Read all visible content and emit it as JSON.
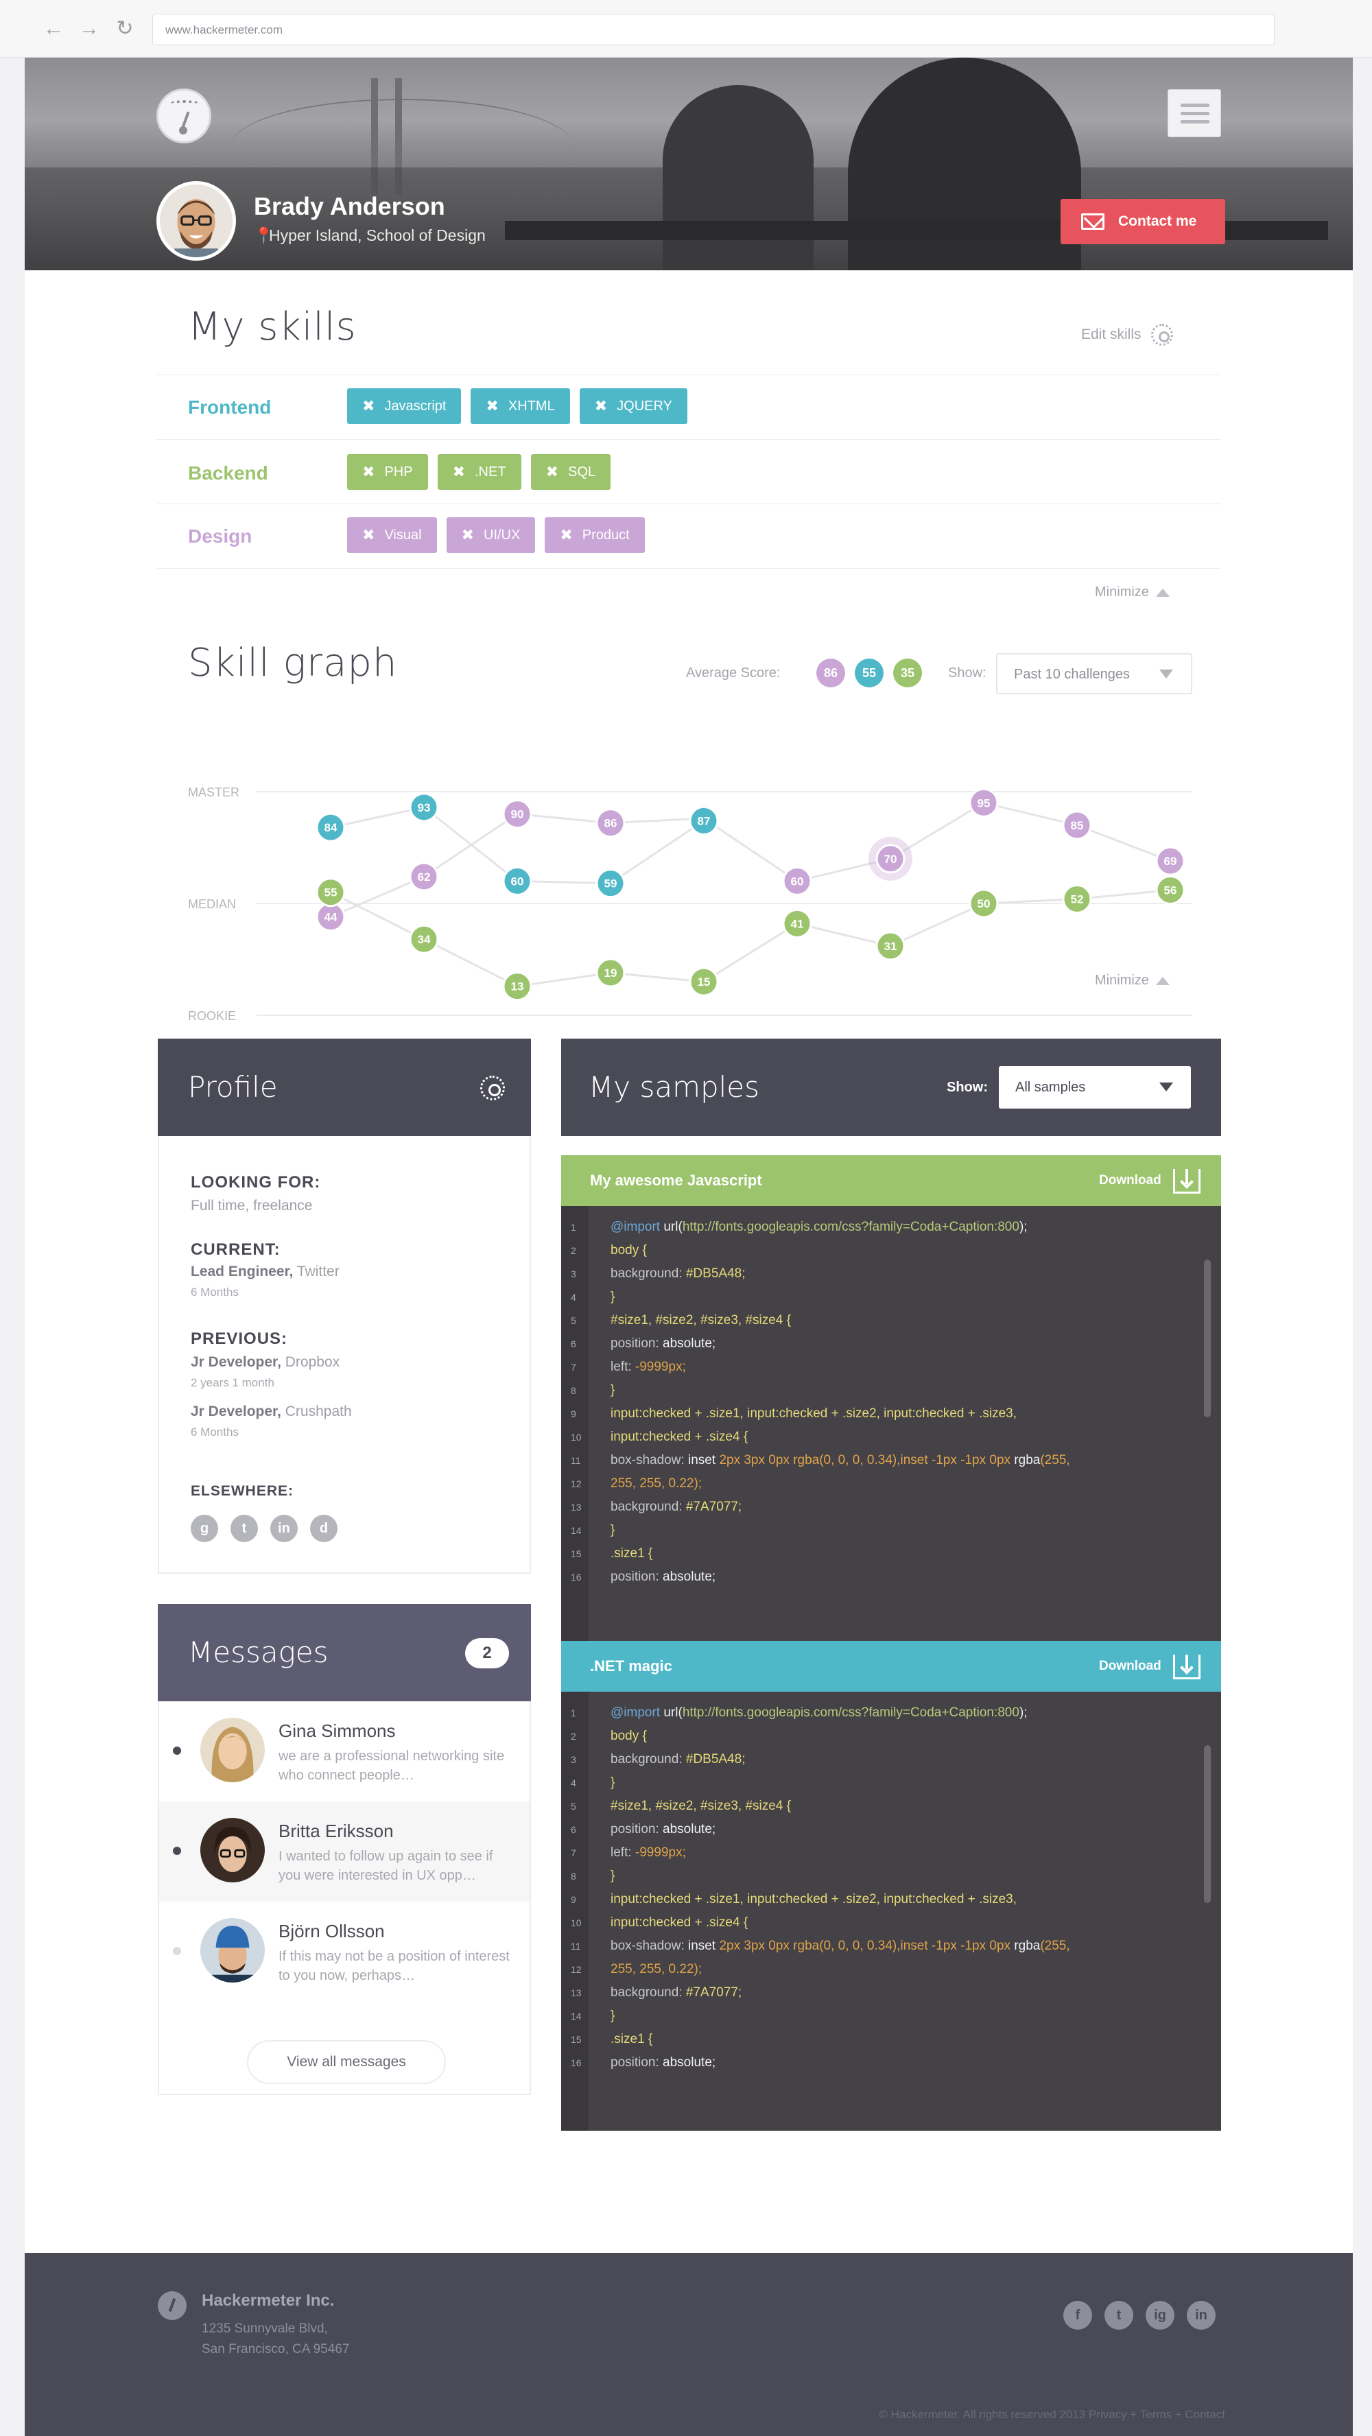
{
  "browser": {
    "url": "www.hackermeter.com",
    "back": "←",
    "forward": "→",
    "reload": "↻"
  },
  "hero": {
    "name": "Brady Anderson",
    "location": "Hyper Island, School of Design",
    "contact_label": "Contact me"
  },
  "skills": {
    "title": "My skills",
    "edit_label": "Edit skills",
    "minimize_label": "Minimize",
    "categories": [
      {
        "name": "Frontend",
        "color": "#4fb8c8",
        "tags": [
          "Javascript",
          "XHTML",
          "JQUERY"
        ]
      },
      {
        "name": "Backend",
        "color": "#9bc46c",
        "tags": [
          "PHP",
          ".NET",
          "SQL"
        ]
      },
      {
        "name": "Design",
        "color": "#c9a6d6",
        "tags": [
          "Visual",
          "UI/UX",
          "Product"
        ]
      }
    ]
  },
  "graph": {
    "title": "Skill graph",
    "avg_label": "Average Score:",
    "avg_scores": [
      {
        "value": "86",
        "color": "#c9a6d6"
      },
      {
        "value": "55",
        "color": "#4fb8c8"
      },
      {
        "value": "35",
        "color": "#9bc46c"
      }
    ],
    "show_label": "Show:",
    "show_value": "Past 10 challenges",
    "minimize_label": "Minimize",
    "y_labels": {
      "master": "MASTER",
      "median": "MEDIAN",
      "rookie": "ROOKIE"
    }
  },
  "chart_data": {
    "type": "line",
    "ylabels": [
      "MASTER",
      "MEDIAN",
      "ROOKIE"
    ],
    "ylim": [
      0,
      100
    ],
    "grid": true,
    "series": [
      {
        "color": "#c9a6d6",
        "points": [
          [
            0,
            44
          ],
          [
            1,
            62
          ],
          [
            2,
            90
          ],
          [
            3,
            86
          ],
          [
            4,
            88
          ],
          [
            5,
            60
          ],
          [
            6,
            70
          ],
          [
            7,
            95
          ],
          [
            8,
            85
          ],
          [
            9,
            69
          ]
        ]
      },
      {
        "color": "#4fb8c8",
        "points": [
          [
            0,
            84
          ],
          [
            1,
            93
          ],
          [
            2,
            60
          ],
          [
            3,
            59
          ],
          [
            4,
            87
          ]
        ]
      },
      {
        "color": "#9bc46c",
        "points": [
          [
            0,
            55
          ],
          [
            1,
            34
          ],
          [
            2,
            13
          ],
          [
            3,
            19
          ],
          [
            4,
            15
          ],
          [
            5,
            41
          ],
          [
            6,
            31
          ],
          [
            7,
            50
          ],
          [
            8,
            52
          ],
          [
            9,
            56
          ]
        ]
      }
    ],
    "highlight": {
      "value": 70,
      "color": "#c9a6d6"
    }
  },
  "profile": {
    "title": "Profile",
    "looking_for_h": "LOOKING FOR:",
    "looking_for_v": "Full time, freelance",
    "current_h": "CURRENT:",
    "current_role": "Lead Engineer,",
    "current_company": "Twitter",
    "current_dur": "6 Months",
    "previous_h": "PREVIOUS:",
    "prev1_role": "Jr Developer,",
    "prev1_company": "Dropbox",
    "prev1_dur": "2 years 1 month",
    "prev2_role": "Jr Developer,",
    "prev2_company": "Crushpath",
    "prev2_dur": "6 Months",
    "elsewhere_h": "ELSEWHERE:",
    "social": [
      "g",
      "t",
      "in",
      "d"
    ]
  },
  "messages": {
    "title": "Messages",
    "count": "2",
    "items": [
      {
        "name": "Gina Simmons",
        "text": "we are a professional networking site who connect people…",
        "unread": true
      },
      {
        "name": "Britta Eriksson",
        "text": "I wanted to follow up again to see if you were interested in UX opp…",
        "unread": true
      },
      {
        "name": "Björn Ollsson",
        "text": "If this may not be a position of interest to you now, perhaps…",
        "unread": false
      }
    ],
    "view_all": "View all messages"
  },
  "samples": {
    "title": "My samples",
    "show_label": "Show:",
    "show_value": "All samples",
    "download_label": "Download",
    "items": [
      {
        "name": "My awesome Javascript",
        "color": "#9bc46c"
      },
      {
        "name": ".NET magic",
        "color": "#4fb8c8"
      }
    ],
    "code": [
      "@import url(http://fonts.googleapis.com/css?family=Coda+Caption:800);",
      "body {",
      "background: #DB5A48;",
      "}",
      "#size1, #size2, #size3, #size4 {",
      "position: absolute;",
      "left: -9999px;",
      "}",
      "input:checked + .size1, input:checked + .size2, input:checked + .size3,",
      "input:checked + .size4 {",
      "box-shadow: inset 2px 3px 0px rgba(0, 0, 0, 0.34),inset -1px -1px 0px rgba(255,",
      "255, 255, 0.22);",
      "background: #7A7077;",
      "}",
      ".size1 {",
      "position: absolute;"
    ]
  },
  "footer": {
    "company": "Hackermeter Inc.",
    "address1": "1235 Sunnyvale Blvd,",
    "address2": "San Francisco, CA 95467",
    "social": [
      "f",
      "t",
      "ig",
      "in"
    ],
    "copyright": "© Hackermeter. All rights reserved 2013     Privacy + Terms + Contact"
  }
}
